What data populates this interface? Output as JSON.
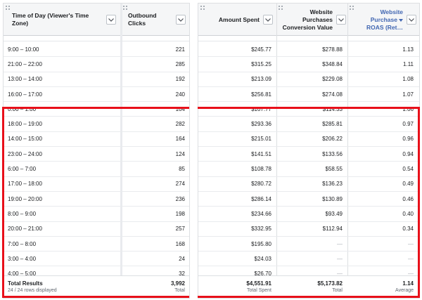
{
  "columns": {
    "time_of_day": "Time of Day (Viewer's Time Zone)",
    "outbound_clicks": "Outbound Clicks",
    "amount_spent": "Amount Spent",
    "conversion_value_line1": "Website",
    "conversion_value_line2": "Purchases",
    "conversion_value_line3": "Conversion Value",
    "roas_line1": "Website",
    "roas_line2": "Purchase",
    "roas_line3": "ROAS (Ret…"
  },
  "rows": [
    {
      "time": "9:00 – 10:00",
      "clicks": "221",
      "spent": "$245.77",
      "value": "$278.88",
      "roas": "1.13"
    },
    {
      "time": "21:00 – 22:00",
      "clicks": "285",
      "spent": "$315.25",
      "value": "$348.84",
      "roas": "1.11"
    },
    {
      "time": "13:00 – 14:00",
      "clicks": "192",
      "spent": "$213.09",
      "value": "$229.08",
      "roas": "1.08"
    },
    {
      "time": "16:00 – 17:00",
      "clicks": "240",
      "spent": "$256.81",
      "value": "$274.08",
      "roas": "1.07"
    },
    {
      "time": "0:00 – 1:00",
      "clicks": "104",
      "spent": "$107.77",
      "value": "$114.33",
      "roas": "1.06"
    },
    {
      "time": "18:00 – 19:00",
      "clicks": "282",
      "spent": "$293.36",
      "value": "$285.81",
      "roas": "0.97"
    },
    {
      "time": "14:00 – 15:00",
      "clicks": "164",
      "spent": "$215.01",
      "value": "$206.22",
      "roas": "0.96"
    },
    {
      "time": "23:00 – 24:00",
      "clicks": "124",
      "spent": "$141.51",
      "value": "$133.56",
      "roas": "0.94"
    },
    {
      "time": "6:00 – 7:00",
      "clicks": "85",
      "spent": "$108.78",
      "value": "$58.55",
      "roas": "0.54"
    },
    {
      "time": "17:00 – 18:00",
      "clicks": "274",
      "spent": "$280.72",
      "value": "$136.23",
      "roas": "0.49"
    },
    {
      "time": "19:00 – 20:00",
      "clicks": "236",
      "spent": "$286.14",
      "value": "$130.89",
      "roas": "0.46"
    },
    {
      "time": "8:00 – 9:00",
      "clicks": "198",
      "spent": "$234.66",
      "value": "$93.49",
      "roas": "0.40"
    },
    {
      "time": "20:00 – 21:00",
      "clicks": "257",
      "spent": "$332.95",
      "value": "$112.94",
      "roas": "0.34"
    },
    {
      "time": "7:00 – 8:00",
      "clicks": "168",
      "spent": "$195.80",
      "value": "—",
      "roas": "—"
    },
    {
      "time": "3:00 – 4:00",
      "clicks": "24",
      "spent": "$24.03",
      "value": "—",
      "roas": "—"
    },
    {
      "time": "4:00 – 5:00",
      "clicks": "32",
      "spent": "$26.70",
      "value": "—",
      "roas": "—"
    }
  ],
  "totals": {
    "label": "Total Results",
    "rows_displayed": "24 / 24 rows displayed",
    "clicks": "3,992",
    "clicks_sub": "Total",
    "spent": "$4,551.91",
    "spent_sub": "Total Spent",
    "value": "$5,173.82",
    "value_sub": "Total",
    "roas": "1.14",
    "roas_sub": "Average"
  },
  "icons": {
    "column_menu": "chevron-down-icon",
    "drag_handle": "grip-icon",
    "sort": "sort-desc-icon"
  },
  "colors": {
    "highlight": "#e8101a",
    "sorted_header": "#4267b2",
    "header_bg": "#f5f6f7"
  }
}
